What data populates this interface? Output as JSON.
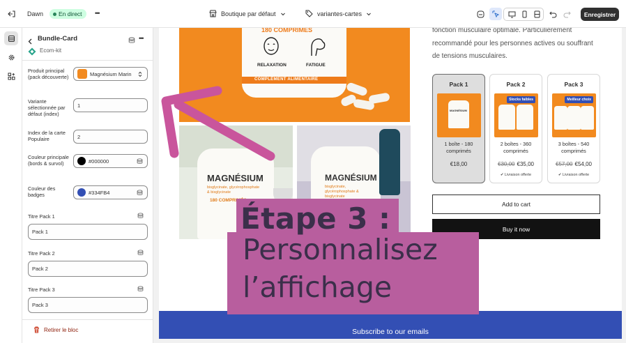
{
  "topbar": {
    "store_name": "Dawn",
    "status_label": "En direct",
    "more_label": "•••",
    "theme_selector": "Boutique par défaut",
    "template_selector": "variantes-cartes",
    "save_label": "Enregistrer"
  },
  "panel": {
    "title": "Bundle-Card",
    "app_name": "Ecom-kit",
    "fields": {
      "product_label": "Produit principal (pack découverte)",
      "product_value": "Magnésium Marin",
      "variant_label": "Variante sélectionnée par défaut (index)",
      "variant_value": "1",
      "popular_label": "Index de la carte Populaire",
      "popular_value": "2",
      "main_color_label": "Couleur principale (bords & survol)",
      "main_color_value": "#000000",
      "badge_color_label": "Couleur des badges",
      "badge_color_value": "#334FB4",
      "pack1_label": "Titre Pack 1",
      "pack1_value": "Pack 1",
      "pack2_label": "Titre Pack 2",
      "pack2_value": "Pack 2",
      "pack3_label": "Titre Pack 3",
      "pack3_value": "Pack 3"
    },
    "remove_label": "Retirer le bloc"
  },
  "preview": {
    "description_lines": [
      "fonction musculaire optimale. Particulièrement",
      "recommandé pour les personnes actives ou souffrant",
      "de tensions musculaires."
    ],
    "product_image_text": {
      "top": "180 COMPRIMÉS",
      "relaxation": "RELAXATION",
      "fatigue": "FATIGUE",
      "band": "COMPLÉMENT ALIMENTAIRE",
      "brand": "MAGNÉSIUM",
      "sub": "bisglycinate, glycérophosphate & bisglycinate",
      "count": "180 COMPRIMÉS"
    },
    "packs": [
      {
        "title": "Pack 1",
        "desc_line1": "1 boîte - 180",
        "desc_line2": "comprimés",
        "old_price": "",
        "price": "€18,00",
        "badge": "",
        "free": ""
      },
      {
        "title": "Pack 2",
        "desc_line1": "2 boîtes - 360",
        "desc_line2": "comprimés",
        "old_price": "€30,00",
        "price": "€35,00",
        "badge": "Stocks faibles",
        "free": "✔ Livraison offerte"
      },
      {
        "title": "Pack 3",
        "desc_line1": "3 boîtes - 540",
        "desc_line2": "comprimés",
        "old_price": "€57,00",
        "price": "€54,00",
        "badge": "Meilleur choix",
        "free": "✔ Livraison offerte"
      }
    ],
    "add_to_cart": "Add to cart",
    "buy_now": "Buy it now",
    "newsletter": "Subscribe to our emails"
  },
  "overlay": {
    "line1": "Étape 3 :",
    "line2": "Personnalisez",
    "line3": "l’affichage"
  },
  "colors": {
    "accent_pink": "#b85e9e",
    "badge_blue": "#334fb4",
    "arrow": "#c9559c"
  }
}
